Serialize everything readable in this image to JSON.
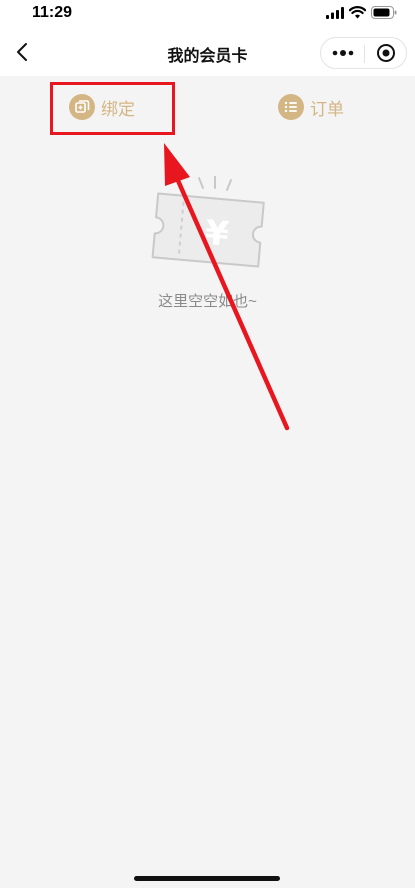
{
  "status_bar": {
    "time": "11:29"
  },
  "nav": {
    "title": "我的会员卡"
  },
  "tabs": [
    {
      "label": "绑定",
      "icon": "bind-card-icon"
    },
    {
      "label": "订单",
      "icon": "order-list-icon"
    }
  ],
  "empty_state": {
    "text": "这里空空如也~",
    "icon": "empty-ticket-icon"
  },
  "colors": {
    "accent": "#d4b584",
    "highlight": "#e8161f",
    "background": "#f4f4f4"
  }
}
